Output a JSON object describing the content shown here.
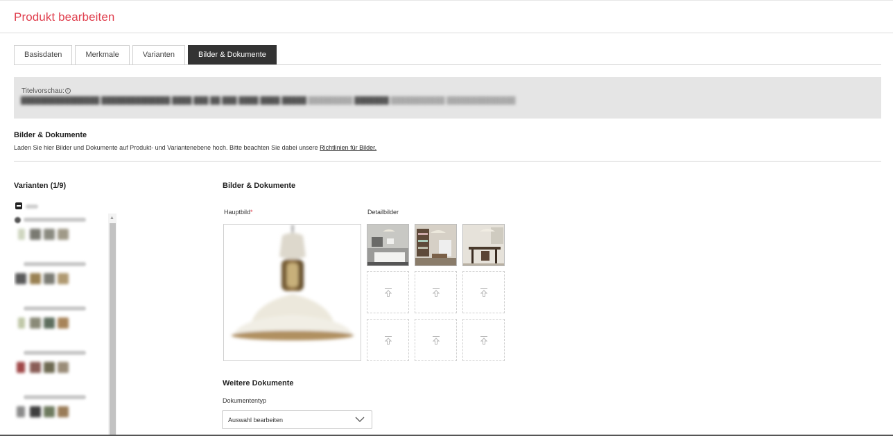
{
  "header": {
    "title": "Produkt bearbeiten"
  },
  "tabs": [
    {
      "label": "Basisdaten",
      "active": false
    },
    {
      "label": "Merkmale",
      "active": false
    },
    {
      "label": "Varianten",
      "active": false
    },
    {
      "label": "Bilder & Dokumente",
      "active": true
    }
  ],
  "title_preview": {
    "label": "Titelvorschau:",
    "info_icon": "info-icon"
  },
  "section": {
    "title": "Bilder & Dokumente",
    "description": "Laden Sie hier Bilder und Dokumente auf Produkt- und Variantenebene hoch. Bitte beachten Sie dabei unsere ",
    "link": "Richtlinien für Bilder."
  },
  "variants": {
    "title": "Varianten (1/9)"
  },
  "media": {
    "title": "Bilder & Dokumente",
    "main_image_label": "Hauptbild",
    "required_mark": "*",
    "detail_label": "Detailbilder",
    "upload_icon": "upload-icon"
  },
  "documents": {
    "title": "Weitere Dokumente",
    "type_label": "Dokumententyp",
    "select_value": "Auswahl bearbeiten",
    "select_icon": "chevron-down-icon"
  },
  "colors": {
    "accent": "#e0404f",
    "active_tab": "#333333",
    "preview_bg": "#e5e5e5"
  }
}
